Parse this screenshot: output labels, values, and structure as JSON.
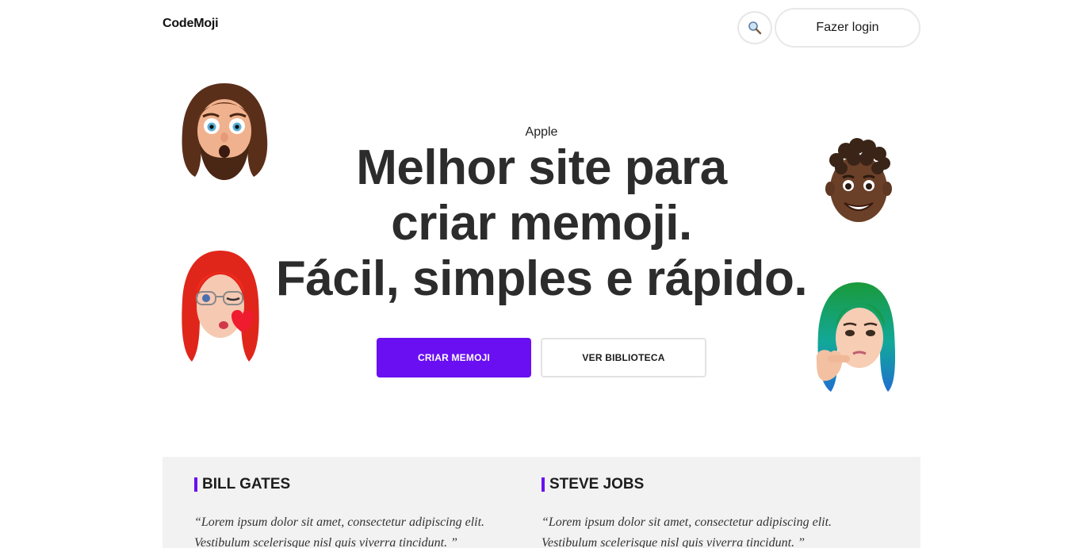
{
  "header": {
    "logo": "CodeMoji",
    "search_icon": "magnifying-glass-icon",
    "login_label": "Fazer login"
  },
  "hero": {
    "eyebrow": "Apple",
    "headline": [
      "Melhor site para",
      "criar memoji.",
      "Fácil, simples e rápido."
    ],
    "primary_button": "CRIAR MEMOJI",
    "secondary_button": "VER BIBLIOTECA"
  },
  "memojis": [
    {
      "name": "bearded-long-hair-memoji",
      "expression": "surprised"
    },
    {
      "name": "curly-hair-memoji",
      "expression": "smiling"
    },
    {
      "name": "red-hair-glasses-memoji",
      "expression": "winking-kiss"
    },
    {
      "name": "green-blue-hair-memoji",
      "expression": "thinking"
    }
  ],
  "testimonials": [
    {
      "name": "BILL GATES",
      "quote": "“Lorem ipsum dolor sit amet, consectetur adipiscing elit. Vestibulum scelerisque nisl quis viverra tincidunt. ”"
    },
    {
      "name": "STEVE JOBS",
      "quote": "“Lorem ipsum dolor sit amet, consectetur adipiscing elit. Vestibulum scelerisque nisl quis viverra tincidunt. ”"
    }
  ],
  "colors": {
    "accent": "#6a0ff2",
    "text": "#2c2c2c",
    "section_bg": "#f2f2f2"
  }
}
